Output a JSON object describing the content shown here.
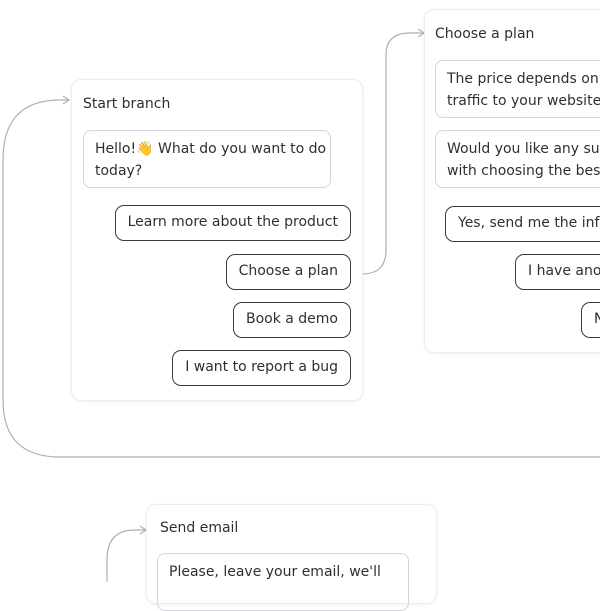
{
  "nodes": {
    "start": {
      "title": "Start branch",
      "message_line1": "Hello!👋 What do you want to do",
      "message_line2": "today?",
      "buttons": [
        "Learn more about the product",
        "Choose a plan",
        "Book a demo",
        "I want to report a bug"
      ]
    },
    "plan": {
      "title": "Choose a plan",
      "messages": [
        {
          "line1": "The price depends on the",
          "line2": "traffic to your website."
        },
        {
          "line1": "Would you like any support",
          "line2": "with choosing the best"
        }
      ],
      "buttons": [
        "Yes, send me the info",
        "I have another",
        "No"
      ]
    },
    "email": {
      "title": "Send email",
      "message_line1": "Please, leave your email, we'll"
    }
  },
  "colors": {
    "connector": "#a9b0bd",
    "button_border": "#3a3a3a",
    "message_border": "#d4d6dc"
  }
}
